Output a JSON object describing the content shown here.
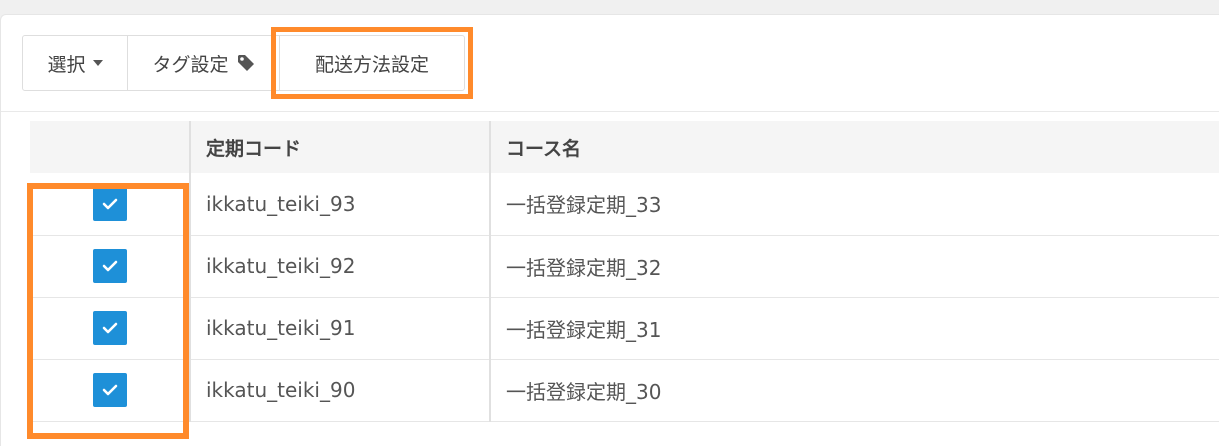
{
  "toolbar": {
    "select_label": "選択",
    "tag_label": "タグ設定",
    "shipping_label": "配送方法設定"
  },
  "table": {
    "headers": [
      "",
      "定期コード",
      "コース名"
    ],
    "rows": [
      {
        "checked": true,
        "code": "ikkatu_teiki_93",
        "course": "一括登録定期_33"
      },
      {
        "checked": true,
        "code": "ikkatu_teiki_92",
        "course": "一括登録定期_32"
      },
      {
        "checked": true,
        "code": "ikkatu_teiki_91",
        "course": "一括登録定期_31"
      },
      {
        "checked": true,
        "code": "ikkatu_teiki_90",
        "course": "一括登録定期_30"
      }
    ]
  },
  "colors": {
    "highlight": "#ff8a2b",
    "checkbox": "#1e90d8"
  },
  "icons": {
    "select_caret": "caret-down-icon",
    "tag": "tag-icon",
    "check": "check-icon"
  }
}
